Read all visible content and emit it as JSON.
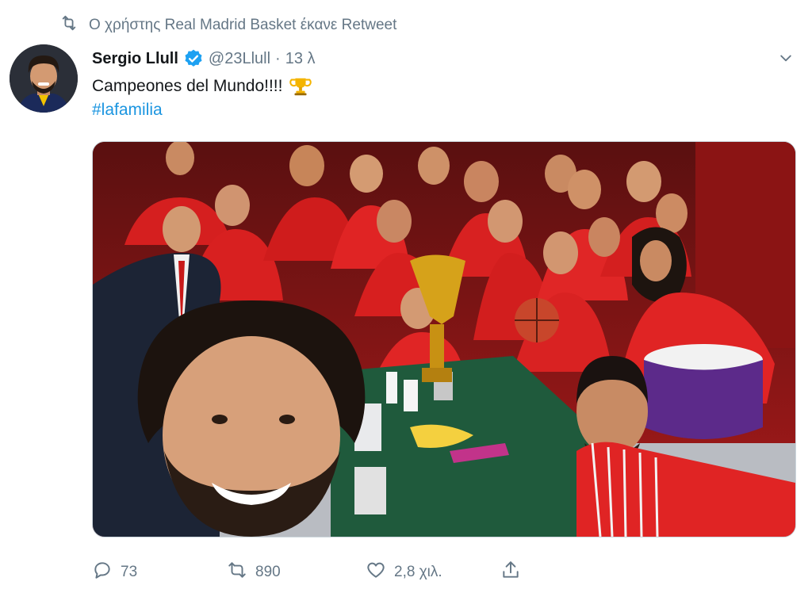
{
  "retweet_context": {
    "text": "Ο χρήστης Real Madrid Basket έκανε Retweet",
    "icon": "retweet-icon"
  },
  "tweet": {
    "author": {
      "name": "Sergio Llull",
      "handle": "@23Llull",
      "verified": true
    },
    "separator": "·",
    "time": "13 λ",
    "text": "Campeones del Mundo!!!!",
    "emoji": "trophy",
    "hashtag": "#lafamilia",
    "actions": {
      "replies": "73",
      "retweets": "890",
      "likes": "2,8 χιλ."
    }
  },
  "colors": {
    "link": "#1b95e0",
    "secondary_text": "#657786",
    "verified": "#1da1f2",
    "team_red": "#d21f1f",
    "table_green": "#1f5a3c"
  }
}
